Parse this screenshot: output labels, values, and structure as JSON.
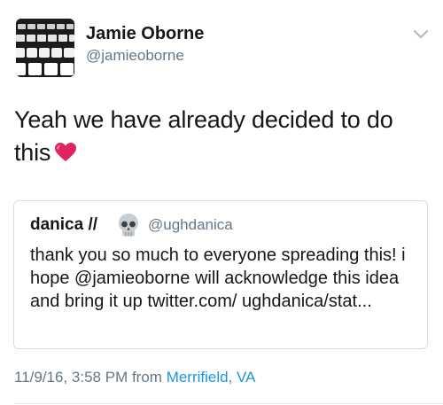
{
  "author": {
    "name": "Jamie Oborne",
    "handle": "@jamieoborne"
  },
  "tweet": {
    "text": "Yeah we have already decided to do this",
    "emoji": "red-heart-icon"
  },
  "quoted": {
    "name": "danica //",
    "emoji": "skull-icon",
    "handle": "@ughdanica",
    "text": "thank you so much to everyone spreading this! i hope @jamieoborne will acknowledge this idea and bring it up twitter.com/ ughdanica/stat..."
  },
  "meta": {
    "timestamp": "11/9/16, 3:58 PM",
    "from_label": "from",
    "location": "Merrifield, VA"
  },
  "colors": {
    "text": "#14171a",
    "secondary": "#657786",
    "link": "#1b95e0",
    "border": "#d7dde2",
    "heart": "#e0245e"
  }
}
